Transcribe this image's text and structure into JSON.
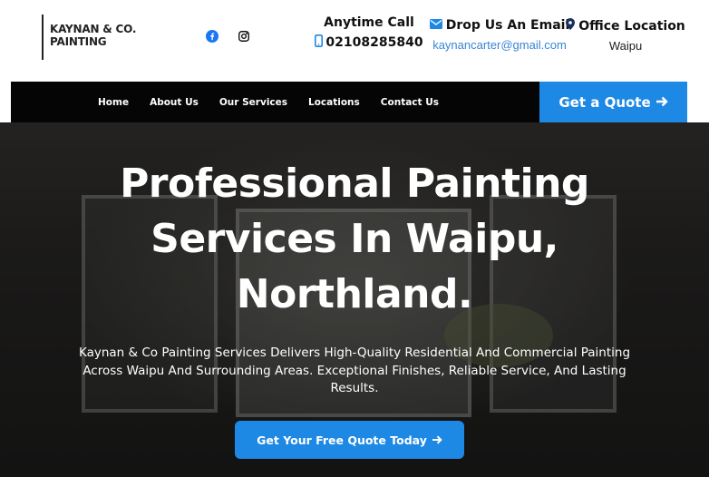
{
  "brand": {
    "logo_line1": "KAYNAN & CO.",
    "logo_line2": "PAINTING"
  },
  "social": {
    "facebook_icon": "facebook-icon",
    "instagram_icon": "instagram-icon"
  },
  "contact": {
    "call_heading": "Anytime Call",
    "phone": "02108285840",
    "email_heading": "Drop Us An Email",
    "email": "kaynancarter@gmail.com",
    "office_heading": "Office Location",
    "office": "Waipu"
  },
  "nav": {
    "items": [
      {
        "label": "Home"
      },
      {
        "label": "About Us"
      },
      {
        "label": "Our Services"
      },
      {
        "label": "Locations"
      },
      {
        "label": "Contact Us"
      }
    ],
    "quote_label": "Get a Quote"
  },
  "hero": {
    "title_line1": "Professional Painting",
    "title_line2": "Services In Waipu,",
    "title_line3": "Northland.",
    "subtitle": "Kaynan & Co Painting Services Delivers High-Quality Residential And Commercial Painting Across Waipu And Surrounding Areas. Exceptional Finishes, Reliable Service, And Lasting Results.",
    "cta_label": "Get Your Free Quote Today"
  },
  "colors": {
    "accent": "#1e88e5",
    "link": "#3a86d4",
    "nav_bg": "#050505"
  }
}
